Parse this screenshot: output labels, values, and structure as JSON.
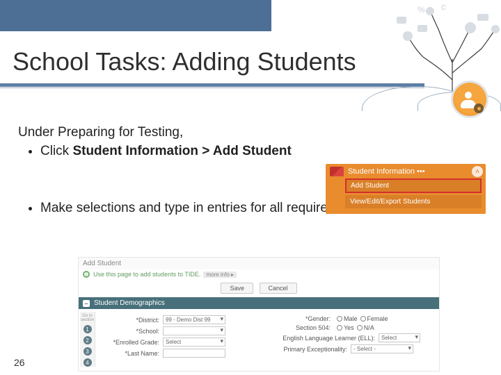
{
  "title": "School Tasks: Adding Students",
  "lead": "Under Preparing for Testing,",
  "bullet1_pre": "Click ",
  "bullet1_bold": "Student Information > Add Student",
  "bullet2": "Make selections and type in entries for all required fields and click Save.",
  "page_number": "26",
  "menu": {
    "header": "Student Information",
    "dots": "•••",
    "row_add": "Add Student",
    "row_view": "View/Edit/Export Students",
    "chevron": "˄"
  },
  "form": {
    "crumb": "Add Student",
    "hint": "Use this page to add students to TIDE.",
    "more": "more info ▸",
    "btn_save": "Save",
    "btn_cancel": "Cancel",
    "section": "Student Demographics",
    "steps_label": "Go to section",
    "left": {
      "district_lbl": "*District:",
      "district_val": "99 - Demo Dist 99",
      "school_lbl": "*School:",
      "grade_lbl": "*Enrolled Grade:",
      "grade_val": "Select",
      "last_lbl": "*Last Name:"
    },
    "right": {
      "gender_lbl": "*Gender:",
      "male": "Male",
      "female": "Female",
      "sec504_lbl": "Section 504:",
      "sec504_yes": "Yes",
      "sec504_no": "N/A",
      "ell_lbl": "English Language Learner (ELL):",
      "ell_val": "Select",
      "excep_lbl": "Primary Exceptionality:",
      "excep_val": "- Select -"
    }
  }
}
